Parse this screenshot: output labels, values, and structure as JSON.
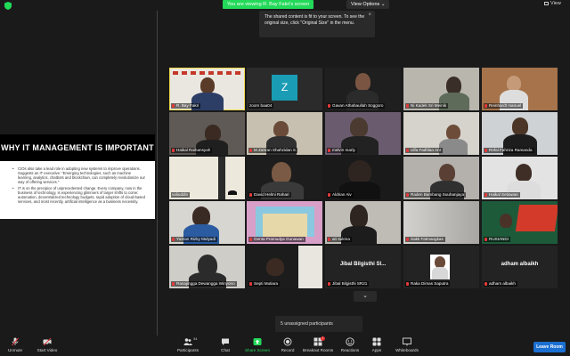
{
  "topbar": {
    "viewing_label": "You are viewing R. Bay Fakri's screen",
    "view_options_label": "View Options ⌄",
    "view_label": "View"
  },
  "tooltip": {
    "text": "The shared content is fit to your screen. To see the original size, click \"Original Size\" in the menu.",
    "close": "×"
  },
  "slide": {
    "title": "WHY IT MANAGEMENT IS IMPORTANT",
    "bullets": [
      "CIOs also take a lead role in adopting new systems to improve operations. Suggests an IT executive: \"Emerging technologies, such as machine learning, analytics, chatbots and blockchain, can completely revolutionize our way of offering services.\"",
      "IT is on the precipice of unprecedented change. Every company, now in the business of technology, is experiencing glimmers of larger shifts to come: automation, decentralized technology budgets, rapid adoption of cloud-based services, and most recently, artificial intelligence as a business necessity."
    ]
  },
  "gallery": {
    "tiles": [
      {
        "name": "R. Bay Fakri",
        "muted": true
      },
      {
        "name": "zoom baa04",
        "muted": false
      },
      {
        "name": "Gavan Athahaullah Soggoro",
        "muted": true
      },
      {
        "name": "Ni Kadek Sri Meinik",
        "muted": true
      },
      {
        "name": "Reinhardt manuel",
        "muted": true
      },
      {
        "name": "Haikal Raihansyah",
        "muted": true
      },
      {
        "name": "M Zahran Shahzidan S",
        "muted": true
      },
      {
        "name": "melvin marly",
        "muted": true
      },
      {
        "name": "Ulfa Fadhlan Anr",
        "muted": true
      },
      {
        "name": "Refal Fahriza Ramanda",
        "muted": true
      },
      {
        "name": "valiuddin",
        "muted": true
      },
      {
        "name": "David Helmi Rahari",
        "muted": true
      },
      {
        "name": "Aldrian Aiv",
        "muted": true
      },
      {
        "name": "Raden Bambang Suuhanjaya",
        "muted": true
      },
      {
        "name": "Haikal Setiawan",
        "muted": true
      },
      {
        "name": "Yusran Rizky Mulyadi",
        "muted": true
      },
      {
        "name": "Genta Pramudya Gunawan",
        "muted": true
      },
      {
        "name": "ari sukma",
        "muted": true
      },
      {
        "name": "Sakti Fatmangkas",
        "muted": true
      },
      {
        "name": "RUSIANDI",
        "muted": true
      },
      {
        "name": "Ranajingga Dewangga Winyono",
        "muted": true
      },
      {
        "name": "Septi Mutiara",
        "muted": true
      },
      {
        "name": "Jibal Bilgisthi SR21",
        "muted": true,
        "big": "Jibal Bilgisthi Sl..."
      },
      {
        "name": "Raka Dimas Saputra",
        "muted": true
      },
      {
        "name": "adham albaikh",
        "muted": true,
        "big": "adham albaikh"
      }
    ],
    "more_label": "⌄",
    "unassigned_label": "5 unassigned participants"
  },
  "toolbar": {
    "unmute": "Unmute",
    "start_video": "Start Video",
    "participants": "Participants",
    "participants_count": "34",
    "chat": "Chat",
    "share_screen": "Share Screen",
    "record": "Record",
    "breakout": "Breakout Rooms",
    "breakout_badge": "1",
    "reactions": "Reactions",
    "apps": "Apps",
    "whiteboards": "Whiteboards",
    "leave": "Leave Room"
  },
  "colors": {
    "accent_green": "#23d959",
    "leave_blue": "#1a6fd1",
    "active_speaker": "#f0d94a",
    "muted_red": "#e23a3a"
  }
}
